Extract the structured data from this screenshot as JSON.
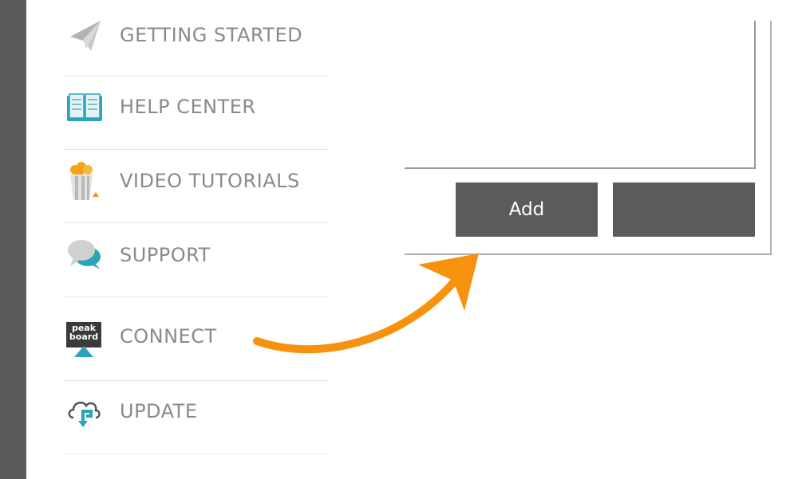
{
  "menu": {
    "items": [
      {
        "label": "GETTING STARTED",
        "icon": "paper-plane-icon"
      },
      {
        "label": "HELP CENTER",
        "icon": "book-icon"
      },
      {
        "label": "VIDEO TUTORIALS",
        "icon": "popcorn-icon"
      },
      {
        "label": "SUPPORT",
        "icon": "chat-bubbles-icon"
      },
      {
        "label": "CONNECT",
        "icon": "peakboard-logo-icon",
        "logo_text": [
          "peak",
          "board"
        ]
      },
      {
        "label": "UPDATE",
        "icon": "cloud-update-icon"
      }
    ]
  },
  "dialog": {
    "add_label": "Add",
    "second_label": ""
  },
  "colors": {
    "sidebar_bar": "#5a5a5a",
    "menu_text": "#8a8a8a",
    "button_bg": "#5b5b5b",
    "arrow": "#f7920f",
    "teal_accent": "#2ba4b8"
  }
}
